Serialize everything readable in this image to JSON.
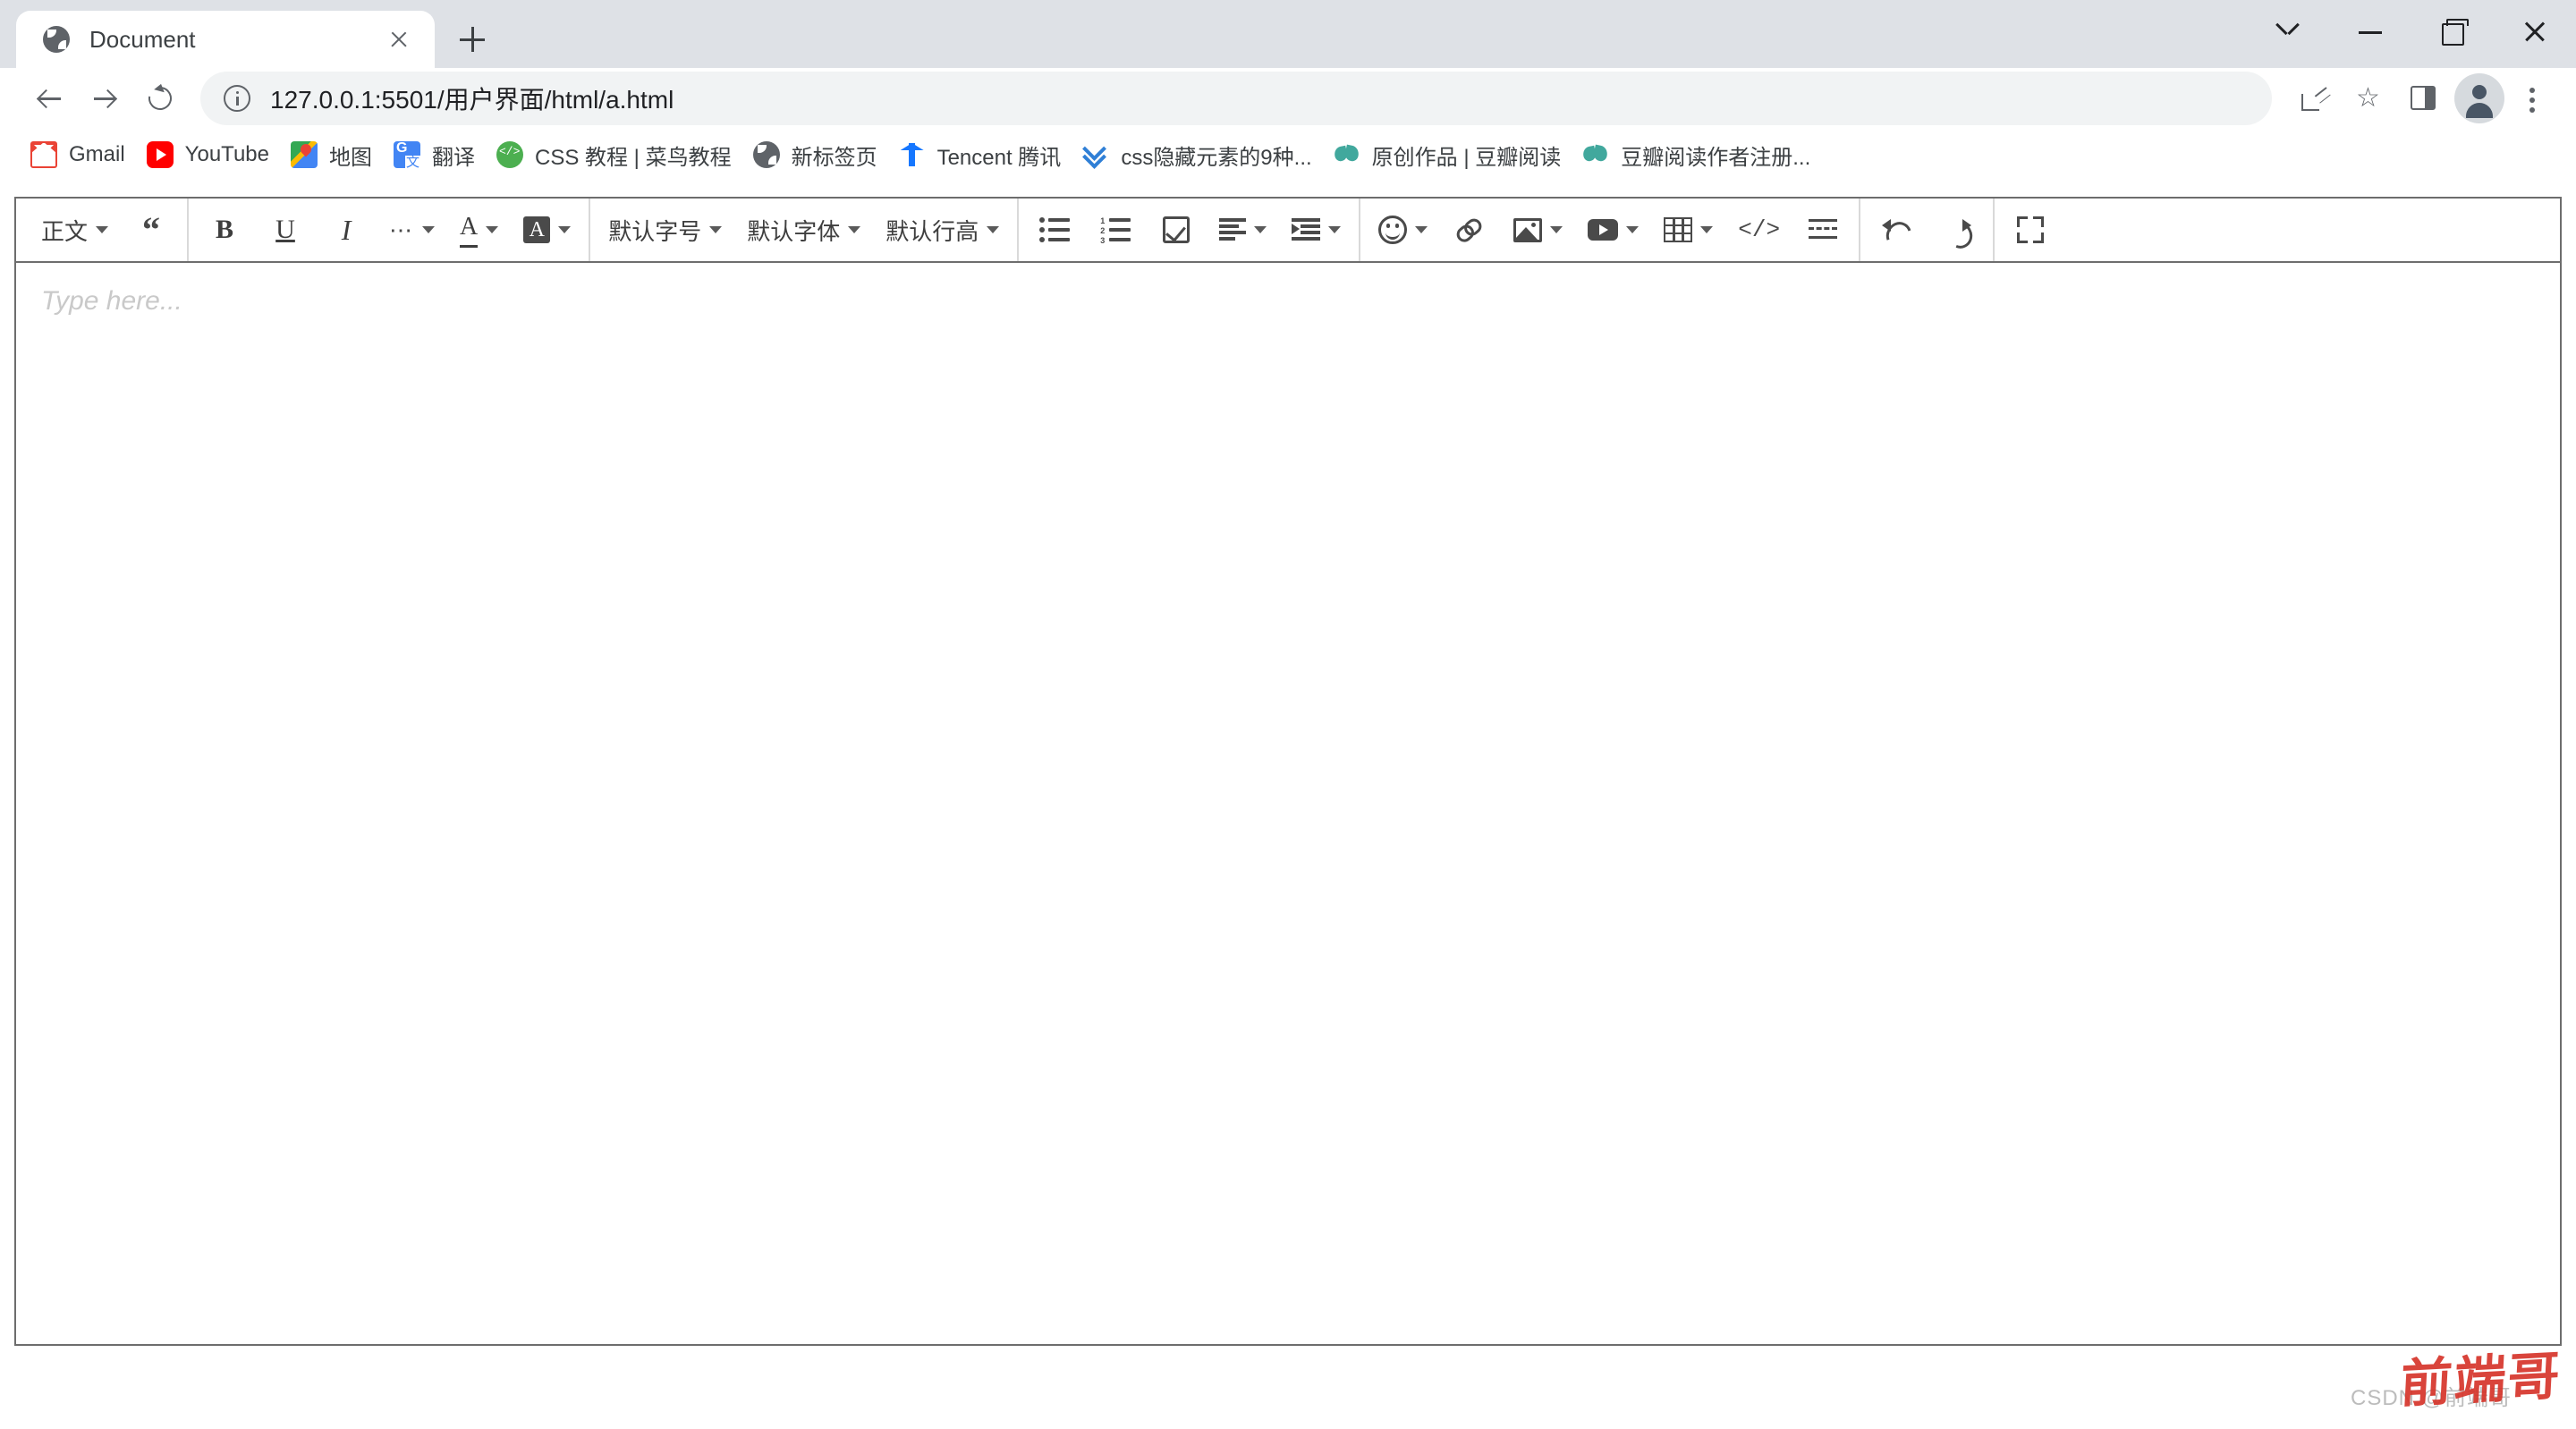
{
  "window": {
    "controls": [
      {
        "name": "tab-search",
        "icon": "chevron-down-icon"
      },
      {
        "name": "minimize",
        "icon": "minimize-icon"
      },
      {
        "name": "maximize",
        "icon": "restore-icon"
      },
      {
        "name": "close",
        "icon": "close-icon"
      }
    ]
  },
  "tabs": [
    {
      "title": "Document",
      "favicon": "globe-icon",
      "active": true
    }
  ],
  "newtab_label": "+",
  "nav": {
    "back": "back-arrow-icon",
    "forward": "forward-arrow-icon",
    "reload": "reload-icon",
    "url_prefix": "127.0.0.1:5501",
    "url_path": "/用户界面/html/a.html",
    "url_full": "127.0.0.1:5501/用户界面/html/a.html",
    "site_info_icon": "info-circle-icon",
    "actions": [
      {
        "name": "share-icon"
      },
      {
        "name": "bookmark-star-icon"
      },
      {
        "name": "side-panel-icon"
      },
      {
        "name": "profile-avatar"
      },
      {
        "name": "chrome-menu-icon"
      }
    ]
  },
  "bookmarks": [
    {
      "label": "Gmail",
      "icon": "gmail-icon"
    },
    {
      "label": "YouTube",
      "icon": "youtube-icon"
    },
    {
      "label": "地图",
      "icon": "google-maps-icon"
    },
    {
      "label": "翻译",
      "icon": "google-translate-icon"
    },
    {
      "label": "CSS 教程 | 菜鸟教程",
      "icon": "runoob-icon"
    },
    {
      "label": "新标签页",
      "icon": "globe-icon"
    },
    {
      "label": "Tencent 腾讯",
      "icon": "tencent-icon"
    },
    {
      "label": "css隐藏元素的9种...",
      "icon": "csdn-icon"
    },
    {
      "label": "原创作品 | 豆瓣阅读",
      "icon": "douban-icon"
    },
    {
      "label": "豆瓣阅读作者注册...",
      "icon": "douban-icon"
    }
  ],
  "editor": {
    "placeholder": "Type here...",
    "content": "",
    "toolbar": {
      "groups": [
        {
          "name": "block-style",
          "items": [
            {
              "name": "paragraph-style-dropdown",
              "label": "正文",
              "type": "dropdown",
              "icon": ""
            },
            {
              "name": "blockquote-button",
              "label": "",
              "type": "icon",
              "icon": "quote-icon"
            }
          ]
        },
        {
          "name": "inline-format",
          "items": [
            {
              "name": "bold-button",
              "label": "B",
              "type": "icon",
              "icon": "bold-icon"
            },
            {
              "name": "underline-button",
              "label": "U",
              "type": "icon",
              "icon": "underline-icon"
            },
            {
              "name": "italic-button",
              "label": "I",
              "type": "icon",
              "icon": "italic-icon"
            },
            {
              "name": "more-format-dropdown",
              "label": "",
              "type": "dropdown",
              "icon": "ellipsis-icon"
            },
            {
              "name": "text-color-dropdown",
              "label": "A",
              "type": "dropdown",
              "icon": "text-color-icon"
            },
            {
              "name": "background-color-dropdown",
              "label": "A",
              "type": "dropdown",
              "icon": "background-color-icon"
            }
          ]
        },
        {
          "name": "typography",
          "items": [
            {
              "name": "font-size-dropdown",
              "label": "默认字号",
              "type": "dropdown",
              "icon": ""
            },
            {
              "name": "font-family-dropdown",
              "label": "默认字体",
              "type": "dropdown",
              "icon": ""
            },
            {
              "name": "line-height-dropdown",
              "label": "默认行高",
              "type": "dropdown",
              "icon": ""
            }
          ]
        },
        {
          "name": "lists-alignment",
          "items": [
            {
              "name": "bullet-list-button",
              "label": "",
              "type": "icon",
              "icon": "bullet-list-icon"
            },
            {
              "name": "ordered-list-button",
              "label": "",
              "type": "icon",
              "icon": "numbered-list-icon"
            },
            {
              "name": "todo-list-button",
              "label": "",
              "type": "icon",
              "icon": "checkbox-list-icon"
            },
            {
              "name": "text-align-dropdown",
              "label": "",
              "type": "dropdown",
              "icon": "align-left-icon"
            },
            {
              "name": "indent-dropdown",
              "label": "",
              "type": "dropdown",
              "icon": "indent-icon"
            }
          ]
        },
        {
          "name": "insert",
          "items": [
            {
              "name": "emoji-dropdown",
              "label": "",
              "type": "dropdown",
              "icon": "emoji-smiley-icon"
            },
            {
              "name": "insert-link-button",
              "label": "",
              "type": "icon",
              "icon": "link-icon"
            },
            {
              "name": "insert-image-dropdown",
              "label": "",
              "type": "dropdown",
              "icon": "image-icon"
            },
            {
              "name": "insert-video-dropdown",
              "label": "",
              "type": "dropdown",
              "icon": "video-icon"
            },
            {
              "name": "insert-table-dropdown",
              "label": "",
              "type": "dropdown",
              "icon": "table-icon"
            },
            {
              "name": "code-block-button",
              "label": "",
              "type": "icon",
              "icon": "code-icon"
            },
            {
              "name": "divider-button",
              "label": "",
              "type": "icon",
              "icon": "horizontal-rule-icon"
            }
          ]
        },
        {
          "name": "history",
          "items": [
            {
              "name": "undo-button",
              "label": "",
              "type": "icon",
              "icon": "undo-icon"
            },
            {
              "name": "redo-button",
              "label": "",
              "type": "icon",
              "icon": "redo-icon"
            }
          ]
        },
        {
          "name": "view",
          "items": [
            {
              "name": "fullscreen-button",
              "label": "",
              "type": "icon",
              "icon": "fullscreen-icon"
            }
          ]
        }
      ]
    }
  },
  "watermark": {
    "csdn_text": "CSDN @前端哥",
    "signature": "前端哥",
    "color": "#d6352b"
  },
  "colors": {
    "tabstrip_bg": "#dee1e6",
    "omnibox_bg": "#f1f3f4",
    "editor_border": "#6d6d6d",
    "toolbar_icon": "#4a4a4a",
    "placeholder": "#c9c9c9"
  }
}
